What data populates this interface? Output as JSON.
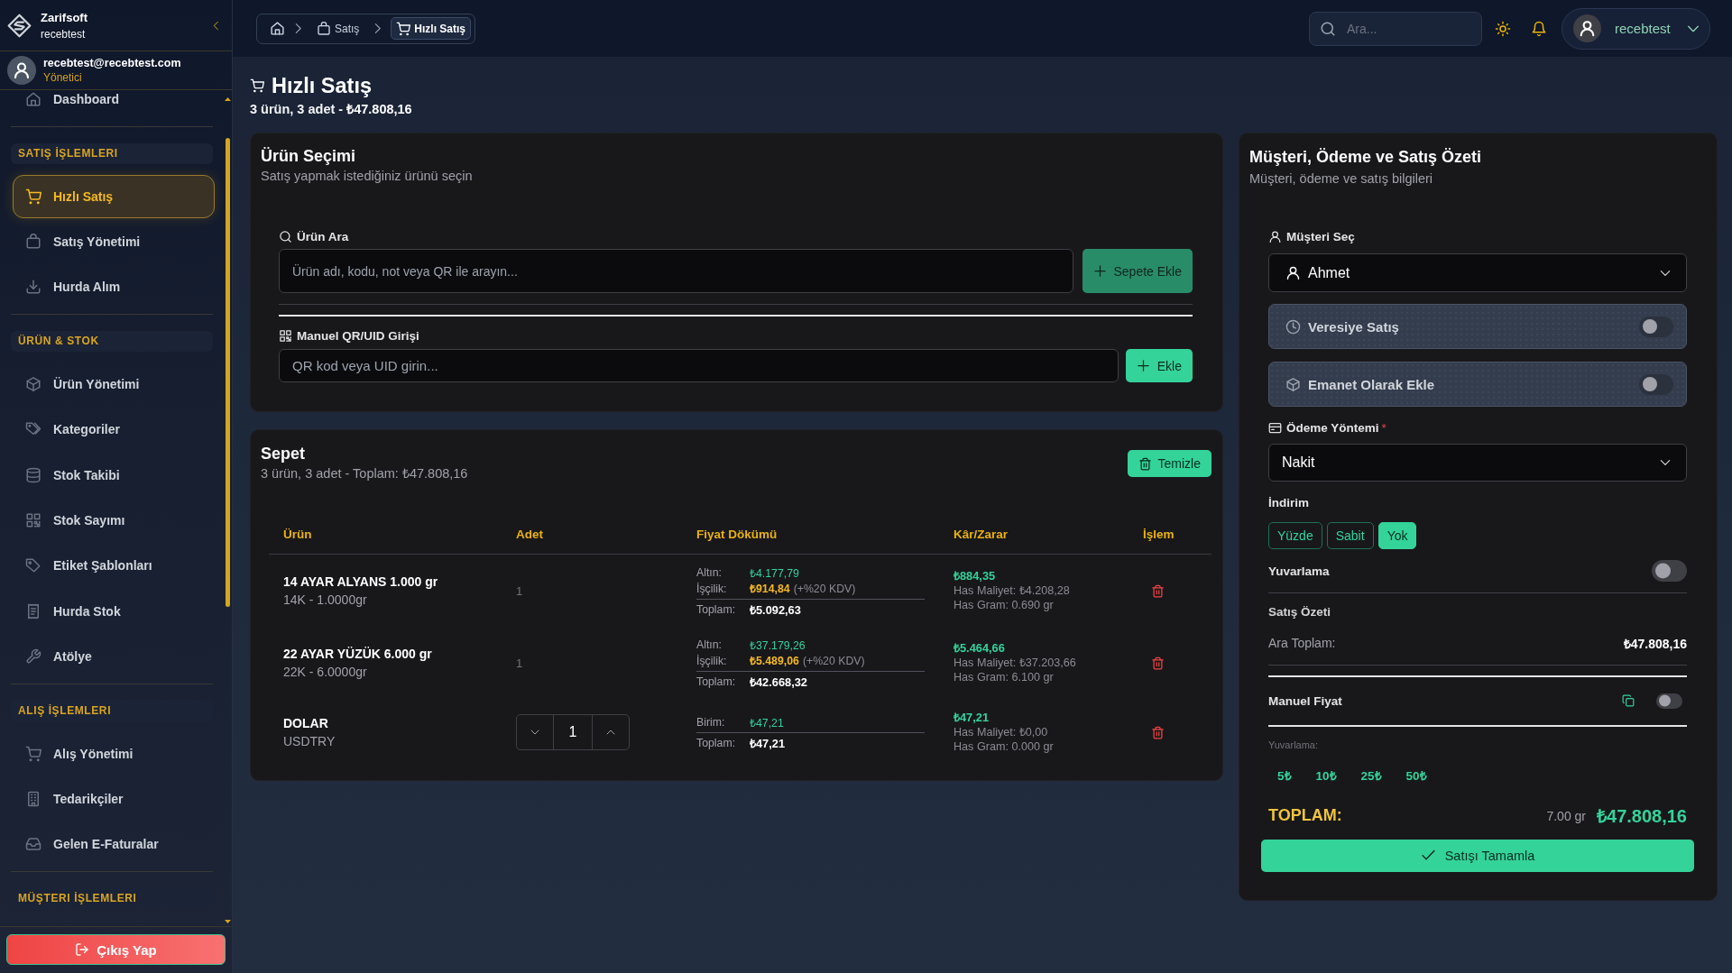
{
  "sidebar": {
    "brand": {
      "name": "Zarifsoft",
      "subtitle": "recebtest"
    },
    "user": {
      "email": "recebtest@recebtest.com",
      "role": "Yönetici"
    },
    "sections": [
      {
        "items": [
          {
            "label": "Dashboard",
            "selected": false
          }
        ]
      },
      {
        "title": "SATIŞ İŞLEMLERI",
        "items": [
          {
            "label": "Hızlı Satış",
            "selected": true
          },
          {
            "label": "Satış Yönetimi",
            "selected": false
          },
          {
            "label": "Hurda Alım",
            "selected": false
          }
        ]
      },
      {
        "title": "ÜRÜN & STOK",
        "items": [
          {
            "label": "Ürün Yönetimi",
            "selected": false
          },
          {
            "label": "Kategoriler",
            "selected": false
          },
          {
            "label": "Stok Takibi",
            "selected": false
          },
          {
            "label": "Stok Sayımı",
            "selected": false
          },
          {
            "label": "Etiket Şablonları",
            "selected": false
          },
          {
            "label": "Hurda Stok",
            "selected": false
          },
          {
            "label": "Atölye",
            "selected": false
          }
        ]
      },
      {
        "title": "ALIŞ İŞLEMLERI",
        "items": [
          {
            "label": "Alış Yönetimi",
            "selected": false
          },
          {
            "label": "Tedarikçiler",
            "selected": false
          },
          {
            "label": "Gelen E-Faturalar",
            "selected": false
          }
        ]
      },
      {
        "title": "MÜŞTERI İŞLEMLERI"
      }
    ],
    "logout_button": "Çıkış Yap"
  },
  "header": {
    "breadcrumb": [
      {
        "label": "Satış",
        "current": false
      },
      {
        "label": "Hızlı Satış",
        "current": true
      }
    ],
    "search": {
      "placeholder": "Ara..."
    },
    "user_menu": {
      "name": "recebtest"
    }
  },
  "page": {
    "title": "Hızlı Satış",
    "subtitle": "3 ürün, 3 adet - **₺47.808,16**"
  },
  "product_selection": {
    "title": "Ürün Seçimi",
    "subtitle": "Satış yapmak istediğiniz ürünü seçin",
    "search": {
      "label": "Ürün Ara",
      "placeholder": "Ürün adı, kodu, not veya QR ile arayın...",
      "button": {
        "label": "Sepete Ekle",
        "disabled": true
      }
    },
    "manual_entry": {
      "label": "Manuel QR/UID Girişi",
      "placeholder": "QR kod veya UID girin...",
      "button": {
        "label": "Ekle",
        "disabled": false
      }
    }
  },
  "cart": {
    "title": "Sepet",
    "subtitle": "3 ürün, 3 adet - Toplam: ₺47.808,16",
    "clear_button": "Temizle",
    "columns": [
      "Ürün",
      "Adet",
      "Fiyat Dökümü",
      "Kâr/Zarar",
      "İşlem"
    ],
    "rows": [
      {
        "name": "14 AYAR ALYANS 1.000 gr",
        "detail": "14K - 1.0000gr",
        "quantity": {
          "kind": "text",
          "value": "1"
        },
        "price_lines": [
          {
            "kind": "metal",
            "label": "Altın:",
            "value": "₺4.177,79"
          },
          {
            "kind": "labor",
            "label": "İşçilik:",
            "value": "₺914,84",
            "note": "(+%20 KDV)"
          },
          {
            "kind": "total",
            "label": "Toplam:",
            "value": "₺5.092,63"
          }
        ],
        "profit": {
          "value": "₺884,35",
          "cost": "Has Maliyet: ₺4.208,28",
          "gram": "Has Gram: 0.690 gr"
        }
      },
      {
        "name": "22 AYAR YÜZÜK 6.000 gr",
        "detail": "22K - 6.0000gr",
        "quantity": {
          "kind": "text",
          "value": "1"
        },
        "price_lines": [
          {
            "kind": "metal",
            "label": "Altın:",
            "value": "₺37.179,26"
          },
          {
            "kind": "labor",
            "label": "İşçilik:",
            "value": "₺5.489,06",
            "note": "(+%20 KDV)"
          },
          {
            "kind": "total",
            "label": "Toplam:",
            "value": "₺42.668,32"
          }
        ],
        "profit": {
          "value": "₺5.464,66",
          "cost": "Has Maliyet: ₺37.203,66",
          "gram": "Has Gram: 6.100 gr"
        }
      },
      {
        "name": "DOLAR",
        "detail": "USDTRY",
        "quantity": {
          "kind": "stepper",
          "value": "1"
        },
        "price_lines": [
          {
            "kind": "unit",
            "label": "Birim:",
            "value": "₺47,21"
          },
          {
            "kind": "total",
            "label": "Toplam:",
            "value": "₺47,21"
          }
        ],
        "profit": {
          "value": "₺47,21",
          "cost": "Has Maliyet: ₺0,00",
          "gram": "Has Gram: 0.000 gr"
        }
      }
    ]
  },
  "summary_panel": {
    "title": "Müşteri, Ödeme ve Satış Özeti",
    "subtitle": "Müşteri, ödeme ve satış bilgileri",
    "customer": {
      "label": "Müşteri Seç",
      "value": "Ahmet"
    },
    "options": [
      {
        "label": "Veresiye Satış",
        "on": false
      },
      {
        "label": "Emanet Olarak Ekle",
        "on": false
      }
    ],
    "payment": {
      "label": "Ödeme Yöntemi",
      "required_mark": "*",
      "value": "Nakit"
    },
    "discount": {
      "label": "İndirim",
      "options": [
        {
          "label": "Yüzde",
          "selected": false
        },
        {
          "label": "Sabit",
          "selected": false
        },
        {
          "label": "Yok",
          "selected": true
        }
      ]
    },
    "rounding_toggle": {
      "label": "Yuvarlama",
      "on": false
    },
    "sale_summary": {
      "title": "Satış Özeti",
      "rows": [
        {
          "label": "Ara Toplam:",
          "value": "₺47.808,16"
        }
      ]
    },
    "manual_price": {
      "label": "Manuel Fiyat",
      "on": false
    },
    "rounding": {
      "label": "Yuvarlama:",
      "options": [
        "5₺",
        "10₺",
        "25₺",
        "50₺"
      ]
    },
    "total": {
      "label": "TOPLAM:",
      "weight": "7.00 gr",
      "value": "₺47.808,16"
    },
    "complete_button": "Satışı Tamamla"
  }
}
